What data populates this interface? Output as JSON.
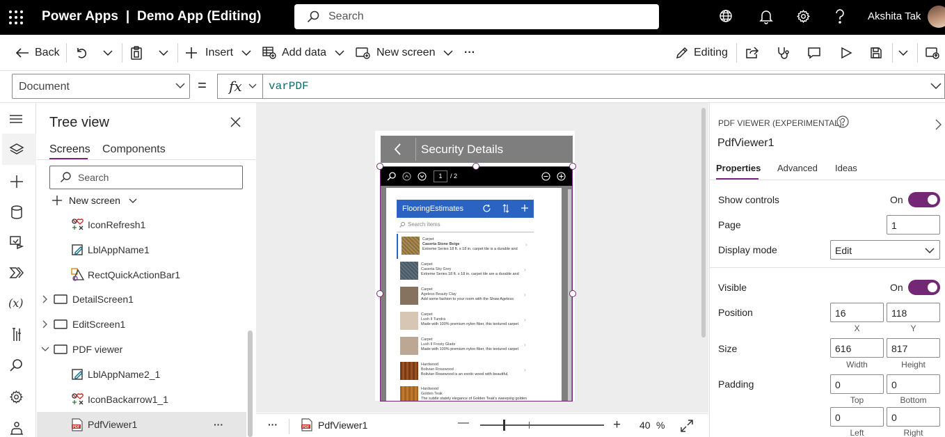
{
  "titlebar": {
    "app_title": "Power Apps  |  Demo App (Editing)",
    "search_placeholder": "Search",
    "user_name": "Akshita Tak",
    "icons": [
      "waffle-icon",
      "search-icon",
      "environment-icon",
      "bell-icon",
      "gear-icon",
      "help-icon"
    ]
  },
  "commandbar": {
    "back": "Back",
    "insert": "Insert",
    "add_data": "Add data",
    "new_screen": "New screen",
    "more": "···",
    "editing": "Editing"
  },
  "formulabar": {
    "property": "Document",
    "equals": "=",
    "fx": "fx",
    "formula": "varPDF"
  },
  "treeview": {
    "title": "Tree view",
    "tabs": [
      "Screens",
      "Components"
    ],
    "search_placeholder": "Search",
    "new_screen": "New screen",
    "items": [
      {
        "label": "IconRefresh1",
        "type": "icon"
      },
      {
        "label": "LblAppName1",
        "type": "label"
      },
      {
        "label": "RectQuickActionBar1",
        "type": "rect"
      },
      {
        "label": "DetailScreen1",
        "type": "screen"
      },
      {
        "label": "EditScreen1",
        "type": "screen"
      },
      {
        "label": "PDF viewer",
        "type": "screen"
      },
      {
        "label": "LblAppName2_1",
        "type": "label"
      },
      {
        "label": "IconBackarrow1_1",
        "type": "icon"
      },
      {
        "label": "PdfViewer1",
        "type": "pdf",
        "more": "···"
      }
    ]
  },
  "canvas": {
    "screen_title": "Security Details",
    "pdf_page": "1",
    "pdf_total": "/ 2",
    "embedded": {
      "header": "FlooringEstimates",
      "search": "Search items",
      "items": [
        {
          "l1": "Carpet",
          "l2": "Caserta Stone Beige",
          "l3": "Extreme Series 18 ft. x 18 in. carpet tile is a durable and"
        },
        {
          "l1": "Carpet",
          "l2": "Caserta Sky Grey",
          "l3": "Extreme Series 18 ft. x 18 in. carpet tile are a durable and"
        },
        {
          "l1": "Carpet",
          "l2": "Ageless Beauty Clay",
          "l3": "Add some fashion to your room with the Shaw Ageless"
        },
        {
          "l1": "Carpet",
          "l2": "Lush II Tundra",
          "l3": "Made with 100% premium nylon fiber, this textured carpet"
        },
        {
          "l1": "Carpet",
          "l2": "Lush II Frosty Glade",
          "l3": "Made with 100% premium nylon fiber, this textured carpet"
        },
        {
          "l1": "Hardwood",
          "l2": "Bolivian Rosewood",
          "l3": "Bolivian Rosewood is an exotic wood with beautiful,"
        },
        {
          "l1": "Hardwood",
          "l2": "Golden Teak",
          "l3": "The subtle stately elegance of Golden Teak's sweeping golden"
        }
      ]
    },
    "bottom": {
      "more": "···",
      "selected": "PdfViewer1",
      "minus": "—",
      "plus": "+",
      "zoom": "40",
      "percent": "%"
    }
  },
  "properties": {
    "control_type": "PDF VIEWER (EXPERIMENTAL)",
    "control_name": "PdfViewer1",
    "tabs": [
      "Properties",
      "Advanced",
      "Ideas"
    ],
    "show_controls_label": "Show controls",
    "show_controls_value": "On",
    "page_label": "Page",
    "page_value": "1",
    "display_mode_label": "Display mode",
    "display_mode_value": "Edit",
    "visible_label": "Visible",
    "visible_value": "On",
    "position_label": "Position",
    "position_x": "16",
    "position_y": "118",
    "x_caption": "X",
    "y_caption": "Y",
    "size_label": "Size",
    "width": "616",
    "height": "817",
    "width_caption": "Width",
    "height_caption": "Height",
    "padding_label": "Padding",
    "padding_top": "0",
    "padding_bottom": "0",
    "padding_left": "0",
    "padding_right": "0",
    "top_caption": "Top",
    "bottom_caption": "Bottom",
    "left_caption": "Left",
    "right_caption": "Right"
  },
  "colors": {
    "accent": "#742774",
    "titlebar": "#000000",
    "embedded_header": "#2b63c3"
  }
}
